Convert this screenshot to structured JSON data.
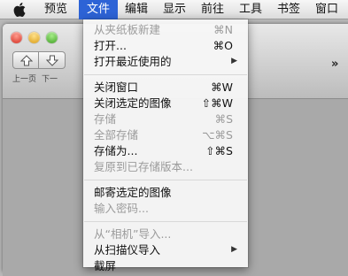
{
  "menubar": {
    "items": [
      {
        "label": "预览"
      },
      {
        "label": "文件"
      },
      {
        "label": "编辑"
      },
      {
        "label": "显示"
      },
      {
        "label": "前往"
      },
      {
        "label": "工具"
      },
      {
        "label": "书签"
      },
      {
        "label": "窗口"
      }
    ]
  },
  "toolbar": {
    "prev_label": "上一页",
    "next_label": "下一",
    "overflow": "»"
  },
  "file_menu": {
    "items": [
      {
        "label": "从夹纸板新建",
        "shortcut": "⌘N",
        "enabled": false
      },
      {
        "label": "打开...",
        "shortcut": "⌘O",
        "enabled": true
      },
      {
        "label": "打开最近使用的",
        "submenu": "▶",
        "enabled": true
      },
      {
        "label": "关闭窗口",
        "shortcut": "⌘W",
        "enabled": true
      },
      {
        "label": "关闭选定的图像",
        "shortcut": "⇧⌘W",
        "enabled": true
      },
      {
        "label": "存储",
        "shortcut": "⌘S",
        "enabled": false
      },
      {
        "label": "全部存储",
        "shortcut": "⌥⌘S",
        "enabled": false
      },
      {
        "label": "存储为...",
        "shortcut": "⇧⌘S",
        "enabled": true
      },
      {
        "label": "复原到已存储版本...",
        "enabled": false
      },
      {
        "label": "邮寄选定的图像",
        "enabled": true
      },
      {
        "label": "输入密码...",
        "enabled": false
      },
      {
        "label": "从“相机”导入...",
        "enabled": false
      },
      {
        "label": "从扫描仪导入",
        "submenu": "▶",
        "enabled": true
      },
      {
        "label": "截屏",
        "enabled": true
      }
    ]
  },
  "colors": {
    "menu_highlight": "#2d63d6",
    "disabled_text": "#9b9b9b"
  }
}
